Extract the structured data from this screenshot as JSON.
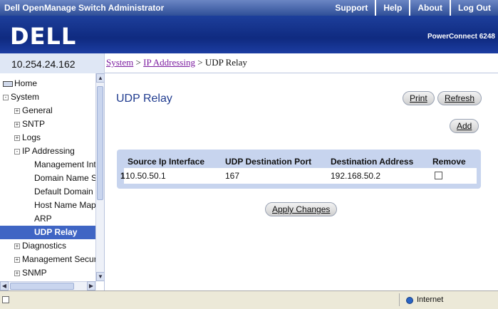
{
  "header": {
    "app_title": "Dell OpenManage Switch Administrator",
    "links": [
      "Support",
      "Help",
      "About",
      "Log Out"
    ],
    "logo_text": "DELL",
    "product": "PowerConnect 6248"
  },
  "device": {
    "ip": "10.254.24.162"
  },
  "breadcrumb": {
    "system": "System",
    "ip_addressing": "IP Addressing",
    "current": "UDP Relay",
    "sep": " > "
  },
  "sidebar": {
    "items": [
      {
        "label": "Home",
        "level": 0,
        "toggle": "",
        "icon": "home-icon"
      },
      {
        "label": "System",
        "level": 0,
        "toggle": "-"
      },
      {
        "label": "General",
        "level": 1,
        "toggle": "+"
      },
      {
        "label": "SNTP",
        "level": 1,
        "toggle": "+"
      },
      {
        "label": "Logs",
        "level": 1,
        "toggle": "+"
      },
      {
        "label": "IP Addressing",
        "level": 1,
        "toggle": "-"
      },
      {
        "label": "Management Inte",
        "level": 2,
        "toggle": ""
      },
      {
        "label": "Domain Name S",
        "level": 2,
        "toggle": ""
      },
      {
        "label": "Default Domain N",
        "level": 2,
        "toggle": ""
      },
      {
        "label": "Host Name Mapp",
        "level": 2,
        "toggle": ""
      },
      {
        "label": "ARP",
        "level": 2,
        "toggle": ""
      },
      {
        "label": "UDP Relay",
        "level": 2,
        "toggle": "",
        "selected": true
      },
      {
        "label": "Diagnostics",
        "level": 1,
        "toggle": "+"
      },
      {
        "label": "Management Secur",
        "level": 1,
        "toggle": "+"
      },
      {
        "label": "SNMP",
        "level": 1,
        "toggle": "+"
      }
    ]
  },
  "main": {
    "title": "UDP Relay",
    "buttons": {
      "print": "Print",
      "refresh": "Refresh",
      "add": "Add",
      "apply": "Apply Changes"
    },
    "table": {
      "headers": [
        "Source Ip Interface",
        "UDP Destination Port",
        "Destination Address",
        "Remove"
      ],
      "rows": [
        {
          "index": "1",
          "source": "10.50.50.1",
          "port": "167",
          "destination": "192.168.50.2",
          "remove": false
        }
      ]
    }
  },
  "statusbar": {
    "zone": "Internet"
  }
}
